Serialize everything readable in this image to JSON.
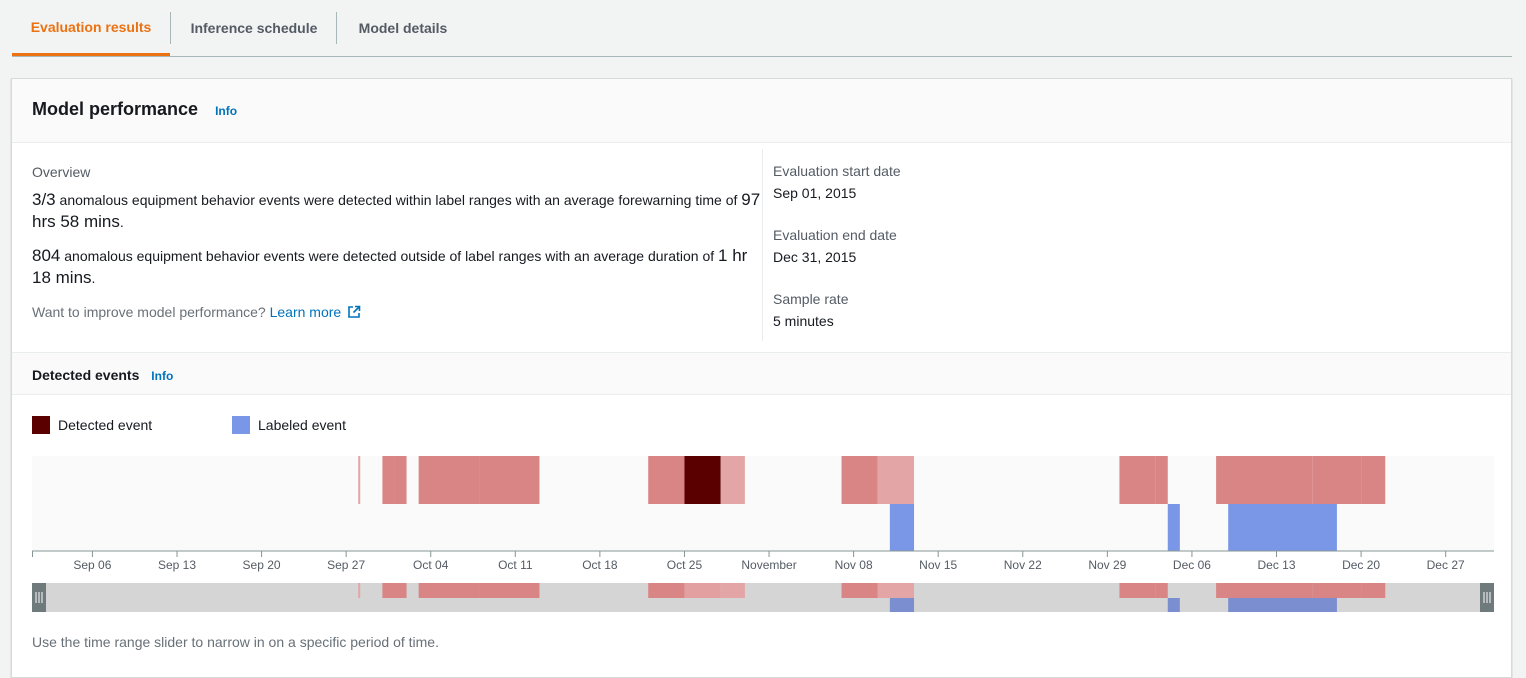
{
  "tabs": [
    {
      "label": "Evaluation results",
      "active": true
    },
    {
      "label": "Inference schedule",
      "active": false
    },
    {
      "label": "Model details",
      "active": false
    }
  ],
  "panel": {
    "title": "Model performance",
    "info_label": "Info",
    "overview_label": "Overview",
    "line1": {
      "count": "3/3",
      "text": " anomalous equipment behavior events were detected within label ranges with an average forewarning time of ",
      "duration": "97 hrs 58 mins",
      "suffix": "."
    },
    "line2": {
      "count": "804",
      "text": " anomalous equipment behavior events were detected outside of label ranges with an average duration of ",
      "duration": "1 hr 18 mins",
      "suffix": "."
    },
    "improve_text": "Want to improve model performance?",
    "learn_more": "Learn more",
    "eval_start_label": "Evaluation start date",
    "eval_start_value": "Sep 01, 2015",
    "eval_end_label": "Evaluation end date",
    "eval_end_value": "Dec 31, 2015",
    "sample_rate_label": "Sample rate",
    "sample_rate_value": "5 minutes"
  },
  "events": {
    "title": "Detected events",
    "info_label": "Info",
    "legend": [
      {
        "label": "Detected event",
        "color": "#5a0000"
      },
      {
        "label": "Labeled event",
        "color": "#7a96e6"
      }
    ],
    "slider_hint": "Use the time range slider to narrow in on a specific period of time."
  },
  "chart_data": {
    "type": "timeline",
    "x_range": [
      "2015-09-01",
      "2015-12-31"
    ],
    "tick_labels": [
      "Sep 06",
      "Sep 13",
      "Sep 20",
      "Sep 27",
      "Oct 04",
      "Oct 11",
      "Oct 18",
      "Oct 25",
      "November",
      "Nov 08",
      "Nov 15",
      "Nov 22",
      "Nov 29",
      "Dec 06",
      "Dec 13",
      "Dec 20",
      "Dec 27"
    ],
    "detected_events": [
      {
        "start": "2015-09-28",
        "end": "2015-09-28",
        "intensity": 0.4
      },
      {
        "start": "2015-09-30",
        "end": "2015-10-01",
        "intensity": 0.5
      },
      {
        "start": "2015-10-01",
        "end": "2015-10-02",
        "intensity": 0.5
      },
      {
        "start": "2015-10-03",
        "end": "2015-10-08",
        "intensity": 0.55
      },
      {
        "start": "2015-10-08",
        "end": "2015-10-13",
        "intensity": 0.5
      },
      {
        "start": "2015-10-22",
        "end": "2015-10-25",
        "intensity": 0.55
      },
      {
        "start": "2015-10-25",
        "end": "2015-10-28",
        "intensity": 1.0
      },
      {
        "start": "2015-10-28",
        "end": "2015-10-30",
        "intensity": 0.35
      },
      {
        "start": "2015-11-07",
        "end": "2015-11-10",
        "intensity": 0.55
      },
      {
        "start": "2015-11-10",
        "end": "2015-11-13",
        "intensity": 0.35
      },
      {
        "start": "2015-11-30",
        "end": "2015-12-03",
        "intensity": 0.55
      },
      {
        "start": "2015-12-03",
        "end": "2015-12-04",
        "intensity": 0.5
      },
      {
        "start": "2015-12-08",
        "end": "2015-12-16",
        "intensity": 0.55
      },
      {
        "start": "2015-12-16",
        "end": "2015-12-19",
        "intensity": 0.5
      },
      {
        "start": "2015-12-19",
        "end": "2015-12-20",
        "intensity": 0.45
      },
      {
        "start": "2015-12-20",
        "end": "2015-12-22",
        "intensity": 0.5
      }
    ],
    "labeled_events": [
      {
        "start": "2015-11-11",
        "end": "2015-11-13"
      },
      {
        "start": "2015-12-04",
        "end": "2015-12-05"
      },
      {
        "start": "2015-12-09",
        "end": "2015-12-18"
      }
    ]
  }
}
